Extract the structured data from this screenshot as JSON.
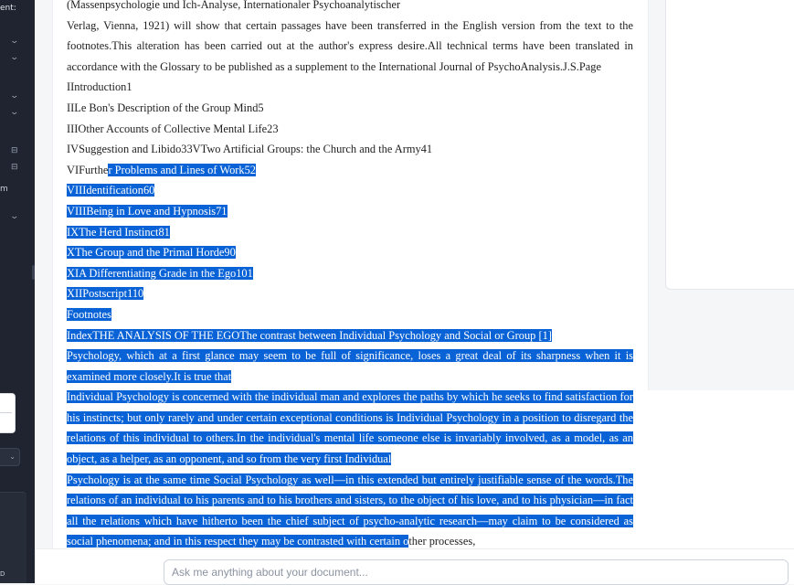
{
  "sidebar": {
    "top_fragment": "ent:",
    "m_fragment": "m",
    "bottom_fragment": "D"
  },
  "document": {
    "lines": {
      "l1": "(Massenpsychologie und Ich-Analyse, Internationaler Psychoanalytischer",
      "l2": "Verlag, Vienna, 1921) will show that certain passages have been transferred in the English version from the text to the footnotes.This alteration has been carried out at the author's express desire.All technical terms have been translated in accordance with the Glossary to be published as a supplement to the International Journal of PsychoAnalysis.J.S.Page",
      "l3": "IIntroduction1",
      "l4": "IILe Bon's Description of the Group Mind5",
      "l5": "IIIOther Accounts of Collective Mental Life23",
      "l6": "IVSuggestion and Libido33VTwo Artificial Groups: the Church and the Army41",
      "l7a": "VIFurthe",
      "l7b": "r Problems and Lines of Work52",
      "l8": "VIIIdentification60",
      "l9": "VIIIBeing in Love and Hypnosis71",
      "l10": "IXThe Herd Instinct81",
      "l11": "XThe Group and the Primal Horde90",
      "l12": "XIA Differentiating Grade in the Ego101",
      "l13": "XIIPostscript110",
      "l14": "Footnotes",
      "l15": "IndexTHE ANALYSIS OF THE EGOThe contrast between Individual Psychology and Social or Group [1]",
      "l16": "Psychology, which at a first glance may seem to be full of significance, loses a great deal of its sharpness when it is examined more closely.It is true that",
      "l17": "Individual Psychology is concerned with the individual man and explores the paths by which he seeks to find satisfaction for his instincts; but only rarely and under certain exceptional conditions is Individual Psychology in a position to disregard the relations of this individual to others.In the individual's mental life someone else is invariably involved, as a model, as an object, as a helper, as an opponent, and so from the very first Individual",
      "l18a": "Psychology is at the same time Social Psychology as well—in this extended but entirely justifiable sense of the words.The relations of an individual to his parents and to his brothers and sisters, to the object of his love, and to his physician—in fact all the relations which have hitherto been the chief subject of psycho-analytic research—may claim to be considered as social phenomena; and in this respect they may be contrasted with certain o",
      "l18b": "ther processes,"
    }
  },
  "chat": {
    "placeholder": "Ask me anything about your document..."
  },
  "colors": {
    "selection": "#0a63d6",
    "sidebar": "#1f2430"
  }
}
